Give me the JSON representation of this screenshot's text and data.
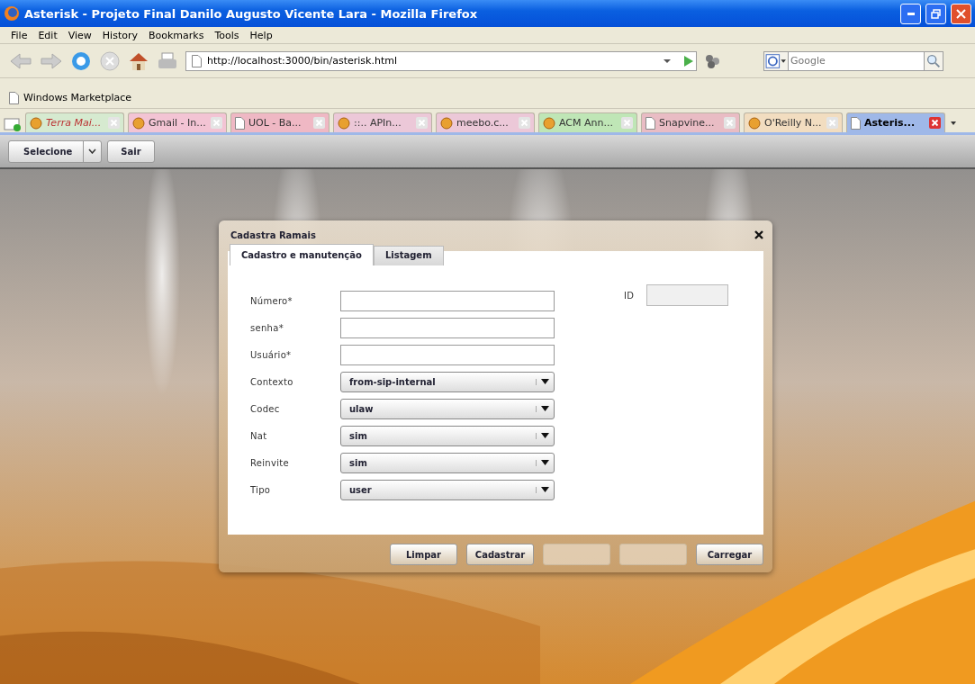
{
  "window": {
    "title": "Asterisk - Projeto Final Danilo Augusto Vicente Lara - Mozilla Firefox"
  },
  "menu": [
    "File",
    "Edit",
    "View",
    "History",
    "Bookmarks",
    "Tools",
    "Help"
  ],
  "address": {
    "value": "http://localhost:3000/bin/asterisk.html"
  },
  "search": {
    "placeholder": "Google"
  },
  "bookmarks": [
    "Windows Marketplace"
  ],
  "tabs": [
    {
      "label": "Terra Mai...",
      "color": "#d6ead0",
      "selected": false,
      "kind": "site"
    },
    {
      "label": "Gmail - In...",
      "color": "#f3c4d4",
      "selected": false,
      "kind": "site"
    },
    {
      "label": "UOL - Ba...",
      "color": "#efb8c4",
      "selected": false,
      "kind": "page"
    },
    {
      "label": "::.. APIn...",
      "color": "#ecc8d8",
      "selected": false,
      "kind": "site"
    },
    {
      "label": "meebo.c...",
      "color": "#ecc8d8",
      "selected": false,
      "kind": "site"
    },
    {
      "label": "ACM Ann...",
      "color": "#bfe6b6",
      "selected": false,
      "kind": "site"
    },
    {
      "label": "Snapvine...",
      "color": "#e9bcc4",
      "selected": false,
      "kind": "page"
    },
    {
      "label": "O'Reilly N...",
      "color": "#f2ddc0",
      "selected": false,
      "kind": "site"
    },
    {
      "label": "Asteris...",
      "color": "#9fb8e8",
      "selected": true,
      "kind": "page"
    }
  ],
  "app_toolbar": {
    "select": "Selecione",
    "button": "Sair"
  },
  "dialog": {
    "title": "Cadastra Ramais",
    "tabs": [
      {
        "label": "Cadastro e manutenção",
        "selected": true
      },
      {
        "label": "Listagem",
        "selected": false
      }
    ],
    "fields": [
      {
        "label": "Número*",
        "kind": "text"
      },
      {
        "label": "senha*",
        "kind": "text"
      },
      {
        "label": "Usuário*",
        "kind": "text"
      },
      {
        "label": "Contexto",
        "kind": "select",
        "value": "from-sip-internal"
      },
      {
        "label": "Codec",
        "kind": "select",
        "value": "ulaw"
      },
      {
        "label": "Nat",
        "kind": "select",
        "value": "sim"
      },
      {
        "label": "Reinvite",
        "kind": "select",
        "value": "sim"
      },
      {
        "label": "Tipo",
        "kind": "select",
        "value": "user"
      }
    ],
    "id_field": {
      "label": "ID",
      "disabled": true
    },
    "buttons": [
      {
        "label": "Limpar",
        "disabled": false
      },
      {
        "label": "Cadastrar",
        "disabled": false
      },
      {
        "disabled": true
      },
      {
        "disabled": true
      },
      {
        "label": "Carregar",
        "disabled": false
      }
    ]
  }
}
